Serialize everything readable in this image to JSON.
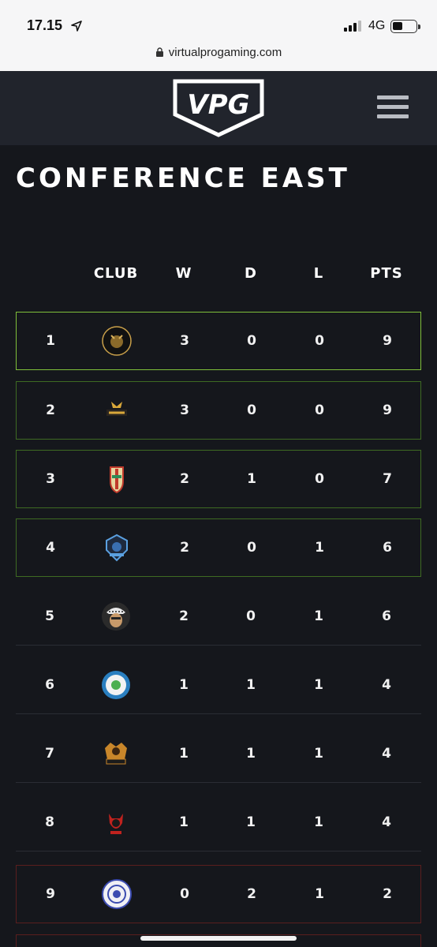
{
  "status_bar": {
    "time": "17.15",
    "network": "4G",
    "url": "virtualprogaming.com"
  },
  "header": {
    "logo_text": "VPG"
  },
  "page": {
    "title": "CONFERENCE EAST"
  },
  "table": {
    "columns": [
      "CLUB",
      "W",
      "D",
      "L",
      "PTS"
    ],
    "rows": [
      {
        "pos": "1",
        "w": "3",
        "d": "0",
        "l": "0",
        "pts": "9",
        "crest": "club-crest-elite-tigers"
      },
      {
        "pos": "2",
        "w": "3",
        "d": "0",
        "l": "0",
        "pts": "9",
        "crest": "club-crest-northside"
      },
      {
        "pos": "3",
        "w": "2",
        "d": "1",
        "l": "0",
        "pts": "7",
        "crest": "club-crest-shield"
      },
      {
        "pos": "4",
        "w": "2",
        "d": "0",
        "l": "1",
        "pts": "6",
        "crest": "club-crest-esports-blue"
      },
      {
        "pos": "5",
        "w": "2",
        "d": "0",
        "l": "1",
        "pts": "6",
        "crest": "club-crest-face"
      },
      {
        "pos": "6",
        "w": "1",
        "d": "1",
        "l": "1",
        "pts": "4",
        "crest": "club-crest-fc-round"
      },
      {
        "pos": "7",
        "w": "1",
        "d": "1",
        "l": "1",
        "pts": "4",
        "crest": "club-crest-gold-esports"
      },
      {
        "pos": "8",
        "w": "1",
        "d": "1",
        "l": "1",
        "pts": "4",
        "crest": "club-crest-red-devils"
      },
      {
        "pos": "9",
        "w": "0",
        "d": "2",
        "l": "1",
        "pts": "2",
        "crest": "club-crest-blue-circle"
      }
    ]
  },
  "colors": {
    "background": "#15171c",
    "header": "#21242c",
    "first_border": "#7fbf3a",
    "promotion_border": "#3e6b22",
    "relegation_border": "#5a1e1e"
  }
}
